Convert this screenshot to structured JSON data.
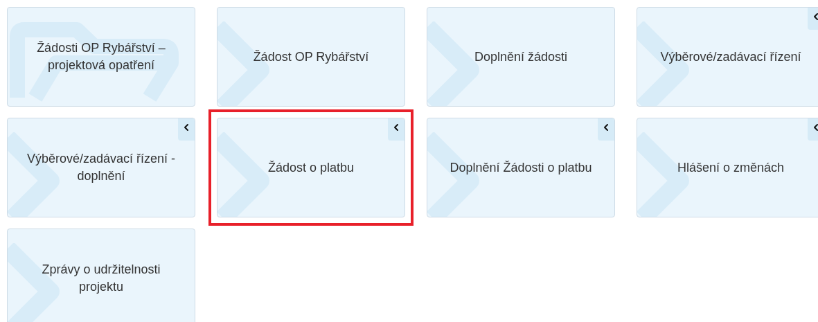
{
  "tiles": [
    {
      "label": "Žádosti OP Rybářství – projektová opatření",
      "kind": "folder",
      "has_toggle": false,
      "selected": false
    },
    {
      "label": "Žádost OP Rybářství",
      "kind": "chevron",
      "has_toggle": false,
      "selected": false
    },
    {
      "label": "Doplnění žádosti",
      "kind": "chevron",
      "has_toggle": false,
      "selected": false
    },
    {
      "label": "Výběrové/zadávací řízení",
      "kind": "chevron",
      "has_toggle": true,
      "selected": false
    },
    {
      "label": "Výběrové/zadávací řízení - doplnění",
      "kind": "chevron",
      "has_toggle": true,
      "selected": false
    },
    {
      "label": "Žádost o platbu",
      "kind": "chevron",
      "has_toggle": true,
      "selected": true
    },
    {
      "label": "Doplnění Žádosti o platbu",
      "kind": "chevron",
      "has_toggle": true,
      "selected": false
    },
    {
      "label": "Hlášení o změnách",
      "kind": "chevron",
      "has_toggle": true,
      "selected": false
    },
    {
      "label": "Zprávy o udržitelnosti projektu",
      "kind": "chevron",
      "has_toggle": false,
      "selected": false
    }
  ]
}
